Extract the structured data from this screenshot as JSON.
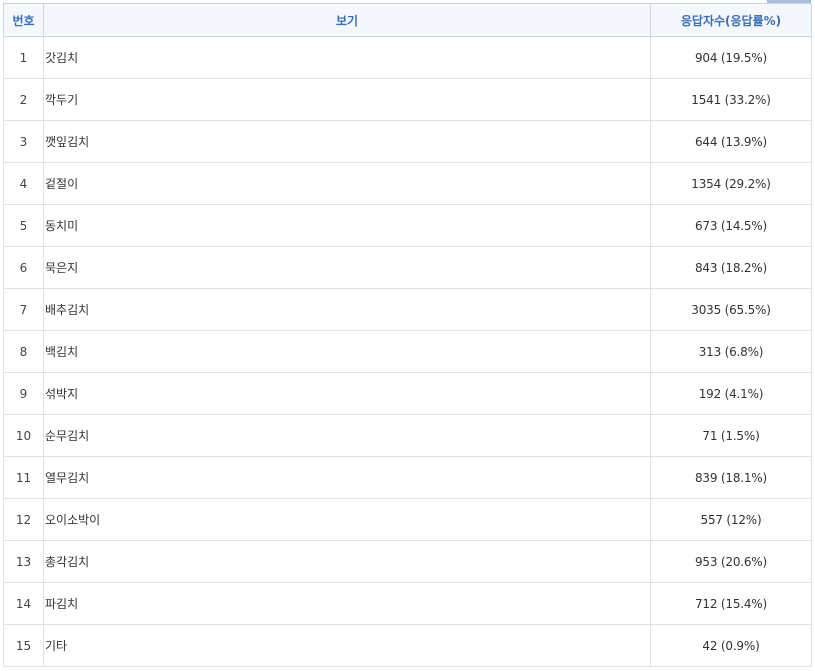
{
  "table": {
    "headers": {
      "number": "번호",
      "option": "보기",
      "responses": "응답자수(응답률%)"
    },
    "rows": [
      {
        "no": "1",
        "option": "갓김치",
        "result": "904 (19.5%)"
      },
      {
        "no": "2",
        "option": "깍두기",
        "result": "1541 (33.2%)"
      },
      {
        "no": "3",
        "option": "깻잎김치",
        "result": "644 (13.9%)"
      },
      {
        "no": "4",
        "option": "겉절이",
        "result": "1354 (29.2%)"
      },
      {
        "no": "5",
        "option": "동치미",
        "result": "673 (14.5%)"
      },
      {
        "no": "6",
        "option": "묵은지",
        "result": "843 (18.2%)"
      },
      {
        "no": "7",
        "option": "배추김치",
        "result": "3035 (65.5%)"
      },
      {
        "no": "8",
        "option": "백김치",
        "result": "313 (6.8%)"
      },
      {
        "no": "9",
        "option": "섞박지",
        "result": "192 (4.1%)"
      },
      {
        "no": "10",
        "option": "순무김치",
        "result": "71 (1.5%)"
      },
      {
        "no": "11",
        "option": "열무김치",
        "result": "839 (18.1%)"
      },
      {
        "no": "12",
        "option": "오이소박이",
        "result": "557 (12%)"
      },
      {
        "no": "13",
        "option": "총각김치",
        "result": "953 (20.6%)"
      },
      {
        "no": "14",
        "option": "파김치",
        "result": "712 (15.4%)"
      },
      {
        "no": "15",
        "option": "기타",
        "result": "42 (0.9%)"
      }
    ]
  }
}
